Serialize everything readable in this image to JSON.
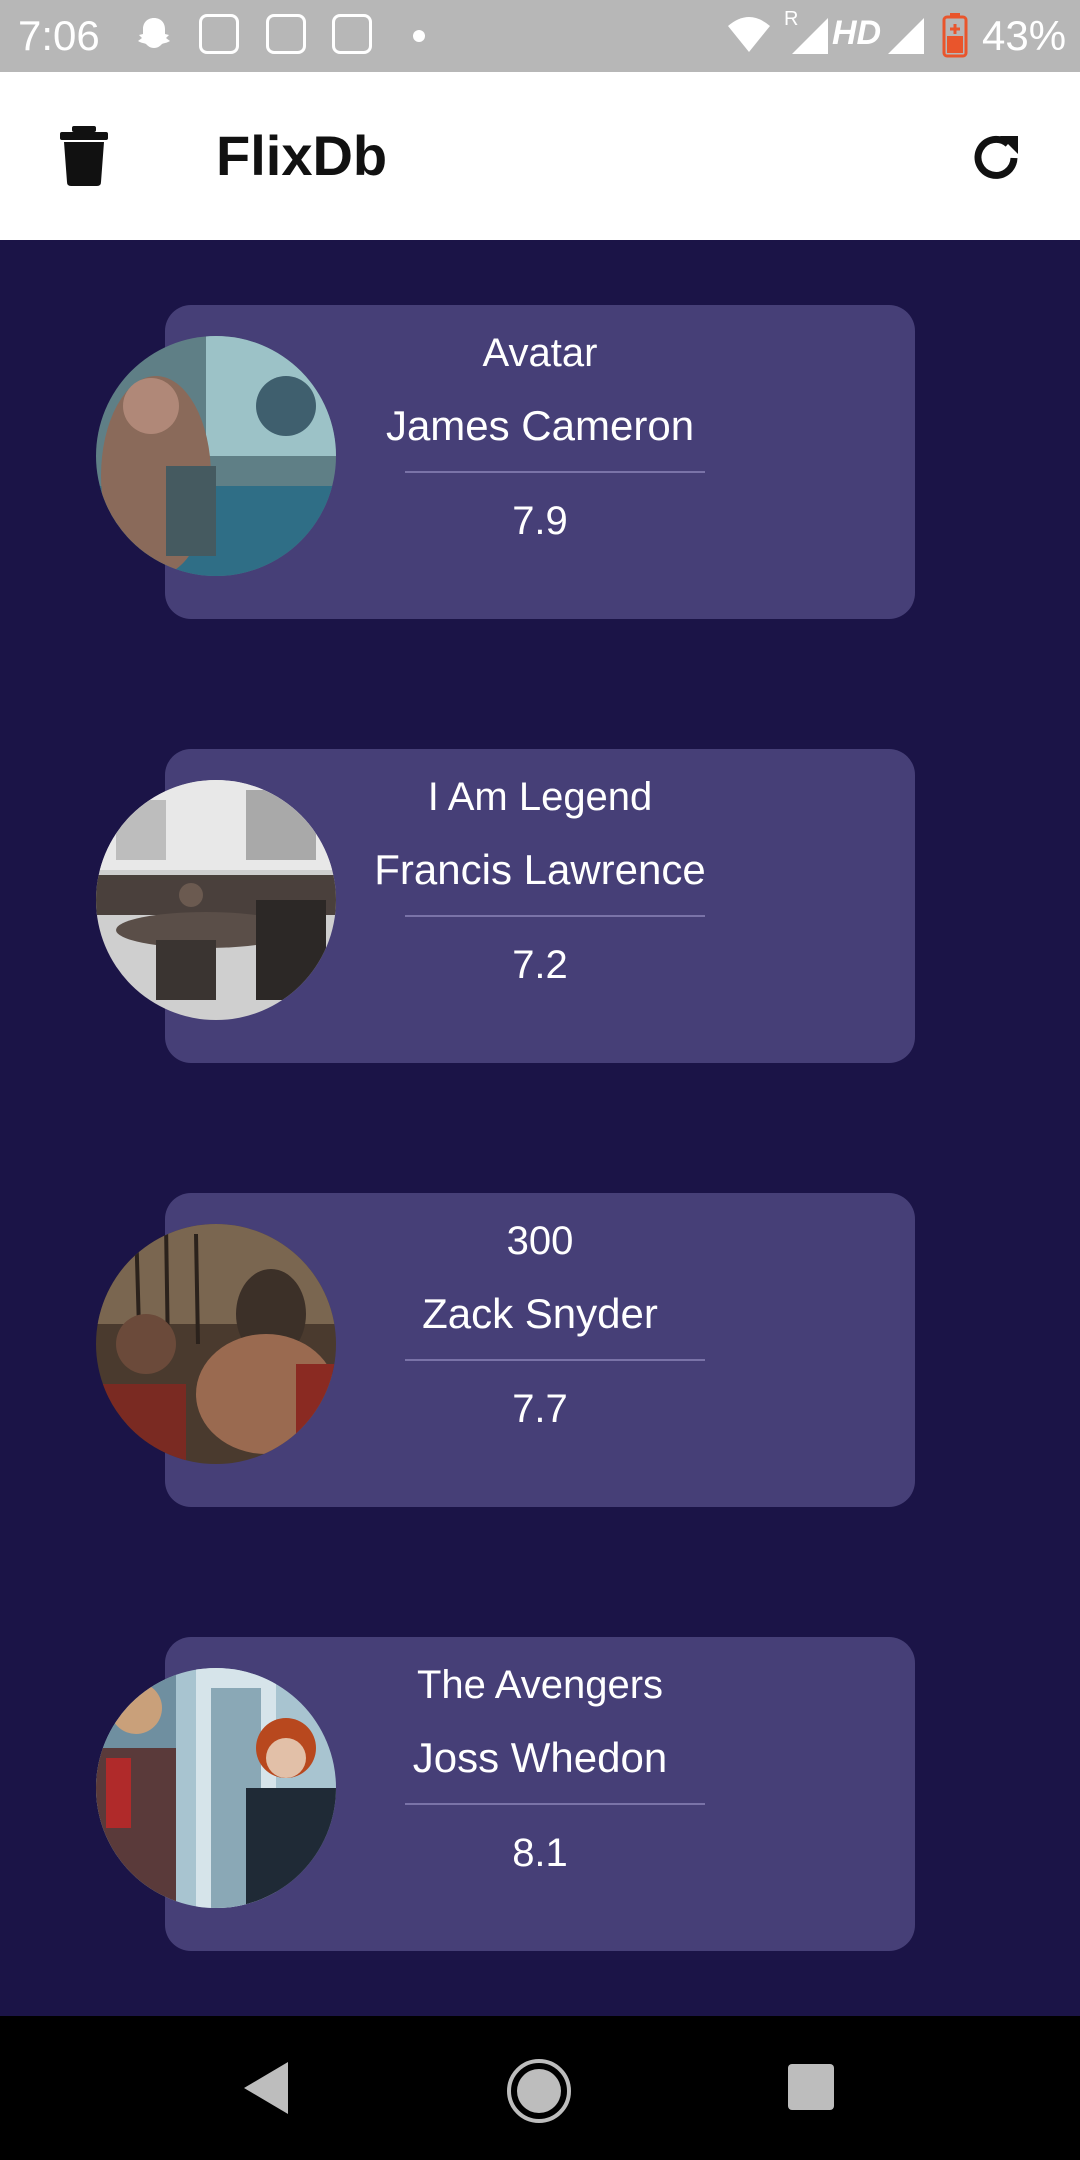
{
  "status_bar": {
    "time": "7:06",
    "network_r": "R",
    "network_hd": "HD",
    "battery": "43%"
  },
  "app_bar": {
    "title": "FlixDb",
    "delete_icon": "trash-icon",
    "refresh_icon": "refresh-icon"
  },
  "movies": [
    {
      "title": "Avatar",
      "director": "James Cameron",
      "rating": "7.9"
    },
    {
      "title": "I Am Legend",
      "director": "Francis Lawrence",
      "rating": "7.2"
    },
    {
      "title": "300",
      "director": "Zack Snyder",
      "rating": "7.7"
    },
    {
      "title": "The Avengers",
      "director": "Joss Whedon",
      "rating": "8.1"
    }
  ],
  "nav_bar": {
    "back_icon": "back-triangle-icon",
    "home_icon": "home-circle-icon",
    "recents_icon": "recents-square-icon"
  },
  "colors": {
    "background": "#1b1447",
    "card": "#463f77",
    "app_bar": "#ffffff"
  }
}
